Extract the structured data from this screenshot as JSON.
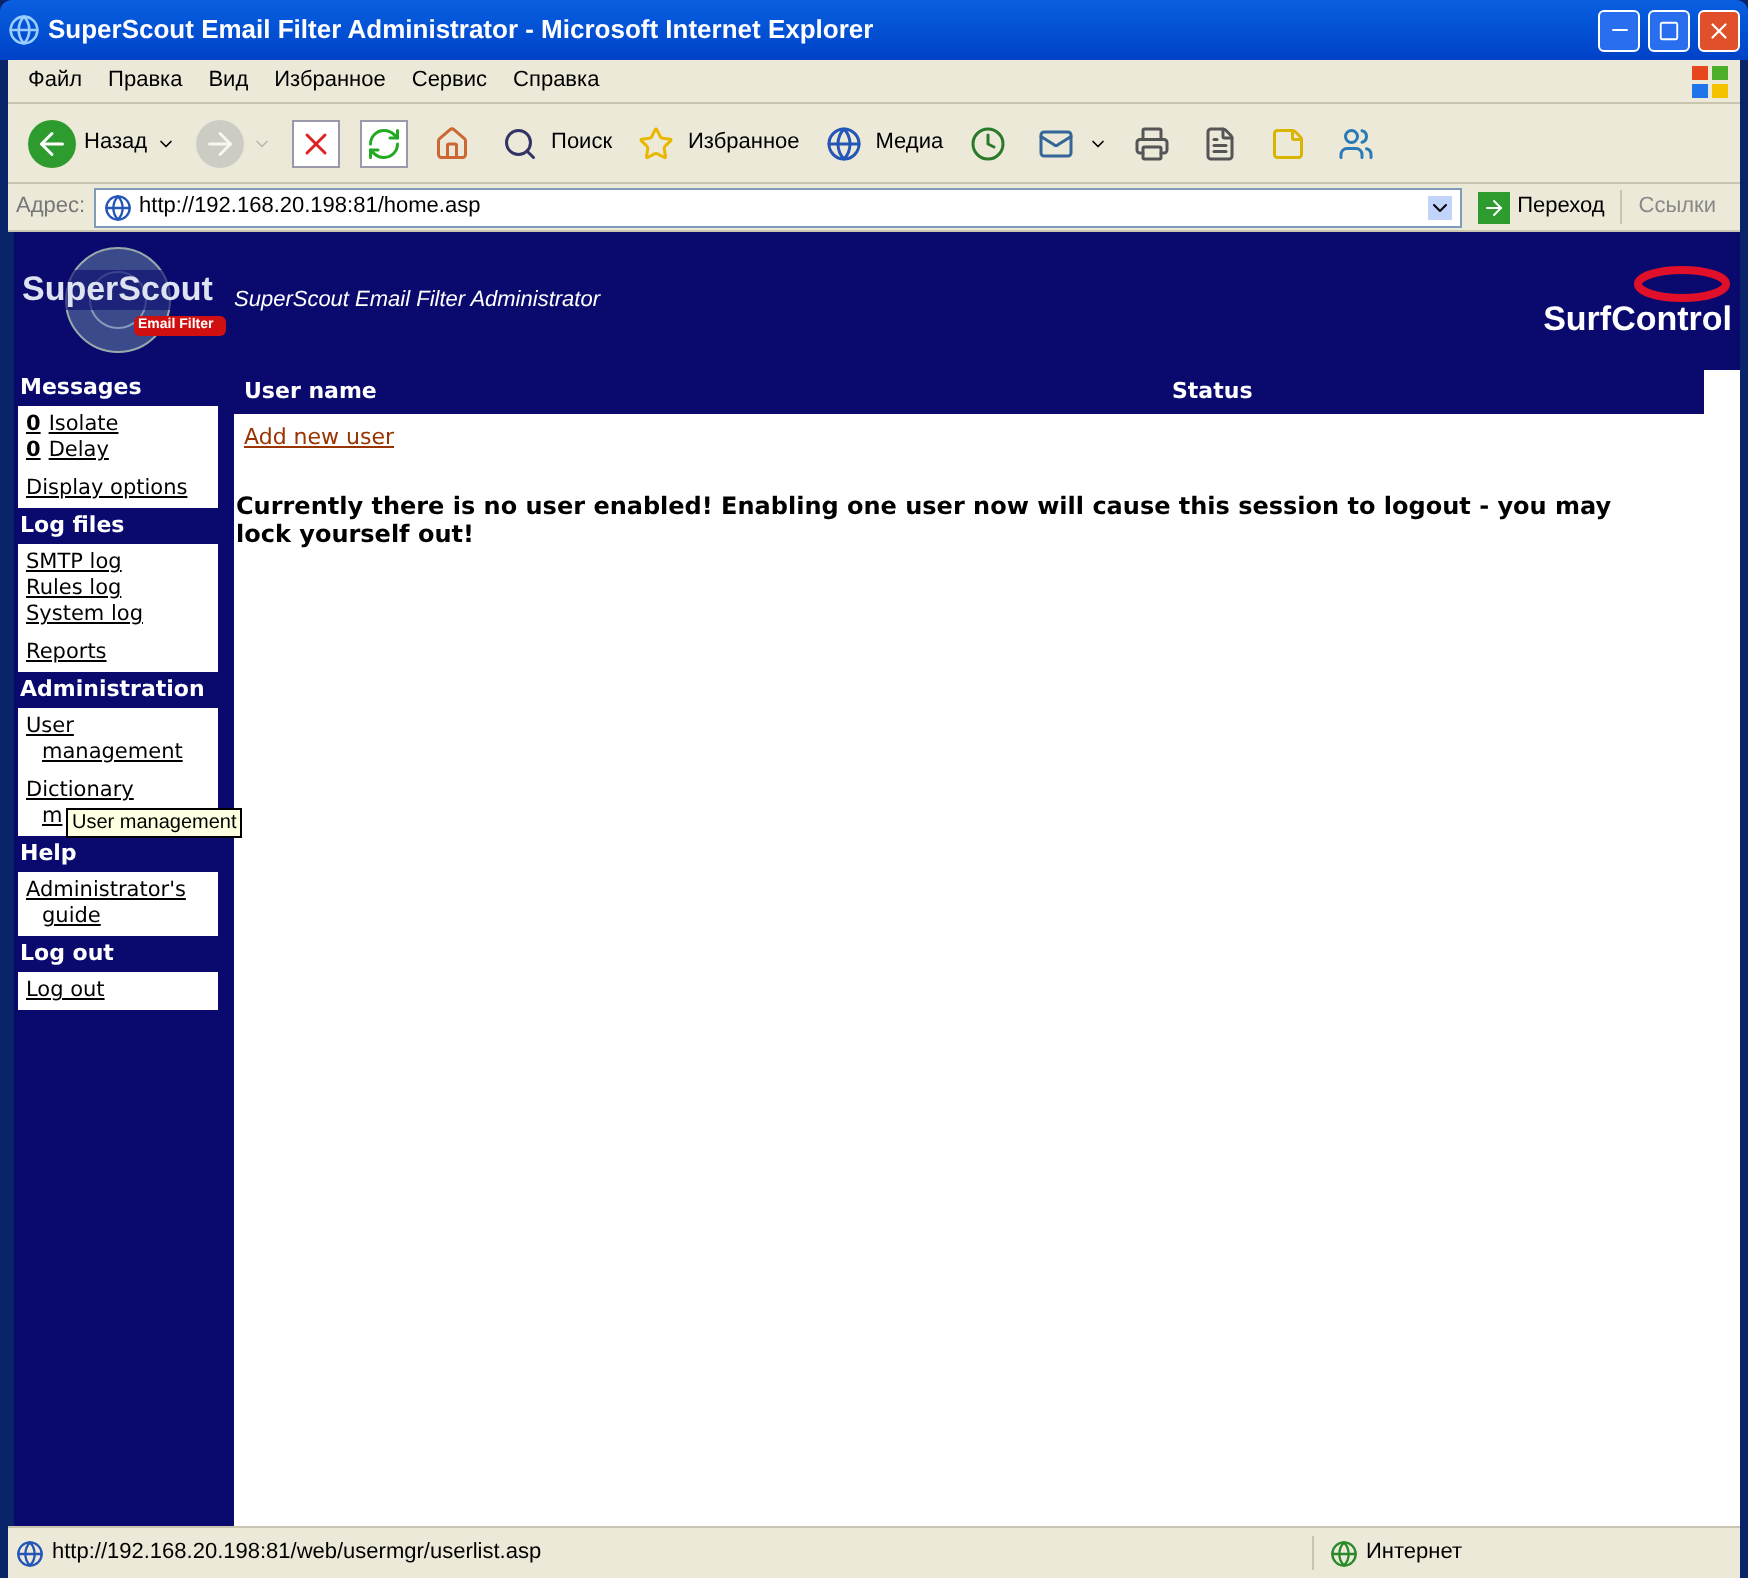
{
  "window": {
    "title": "SuperScout Email Filter Administrator - Microsoft Internet Explorer"
  },
  "menu": [
    "Файл",
    "Правка",
    "Вид",
    "Избранное",
    "Сервис",
    "Справка"
  ],
  "toolbar": [
    {
      "kind": "back",
      "label": "Назад",
      "disabled": false
    },
    {
      "kind": "forward",
      "disabled": true
    },
    {
      "kind": "stop"
    },
    {
      "kind": "refresh"
    },
    {
      "kind": "home"
    },
    {
      "kind": "search",
      "label": "Поиск"
    },
    {
      "kind": "favorites",
      "label": "Избранное"
    },
    {
      "kind": "media",
      "label": "Медиа"
    },
    {
      "kind": "history"
    },
    {
      "kind": "mail"
    },
    {
      "kind": "print"
    },
    {
      "kind": "edit"
    },
    {
      "kind": "note"
    },
    {
      "kind": "messenger"
    }
  ],
  "address": {
    "label": "Адрес:",
    "url": "http://192.168.20.198:81/home.asp",
    "go": "Переход",
    "links": "Ссылки"
  },
  "banner": {
    "logo": "SuperScout",
    "logo_badge": "Email Filter",
    "title": "SuperScout Email Filter Administrator",
    "brand": "SurfControl"
  },
  "sidebar": [
    {
      "heading": "Messages",
      "groups": [
        [
          {
            "count": "0",
            "label": "Isolate"
          },
          {
            "count": "0",
            "label": "Delay"
          }
        ],
        [
          {
            "label": "Display options"
          }
        ]
      ]
    },
    {
      "heading": "Log files",
      "groups": [
        [
          {
            "label": "SMTP log"
          },
          {
            "label": "Rules log"
          },
          {
            "label": "System log"
          }
        ],
        [
          {
            "label": "Reports"
          }
        ]
      ]
    },
    {
      "heading": "Administration",
      "groups": [
        [
          {
            "label": "User management"
          }
        ],
        [
          {
            "lines": [
              "Dictionary",
              "m"
            ]
          }
        ]
      ]
    },
    {
      "heading": "Help",
      "groups": [
        [
          {
            "label": "Administrator's guide"
          }
        ]
      ]
    },
    {
      "heading": "Log out",
      "groups": [
        [
          {
            "label": "Log out"
          }
        ]
      ]
    }
  ],
  "tooltip": "User management",
  "table": {
    "columns": [
      "User name",
      "Status"
    ]
  },
  "add_link": "Add new user",
  "message": "Currently there is no user enabled! Enabling one user now will cause this session to logout - you may lock yourself out!",
  "status_bar": {
    "url": "http://192.168.20.198:81/web/usermgr/userlist.asp",
    "zone": "Интернет"
  }
}
